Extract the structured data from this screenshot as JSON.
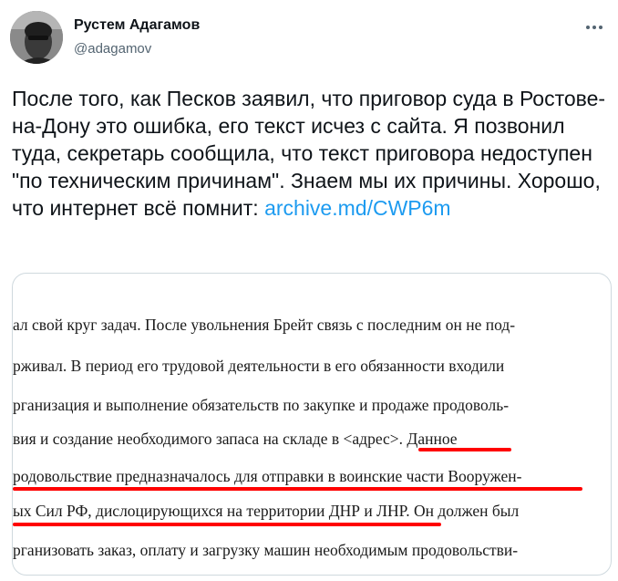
{
  "author": {
    "name": "Рустем Адагамов",
    "handle": "@adagamov"
  },
  "icons": {
    "more": "more-horizontal-icon",
    "avatar": "profile-photo"
  },
  "tweet": {
    "text": "После того, как Песков заявил, что приговор суда в Ростове-на-Дону это ошибка, его текст исчез с сайта. Я позвонил туда, секретарь сообщила, что текст приговора недоступен \"по техническим причинам\". Знаем мы их причины. Хорошо, что интернет всё помнит: ",
    "link": "archive.md/CWP6m"
  },
  "document_image": {
    "lines": [
      "ал свой круг задач. После увольнения Брейт связь с последним он не под-",
      "рживал. В период его трудовой деятельности в его обязанности входили",
      "рганизация и выполнение обязательств по закупке и продаже продоволь-",
      "вия и создание необходимого запаса на складе в <адрес>. Данное",
      "родовольствие предназначалось для отправки в воинские части Вооружен-",
      "ых Сил РФ, дислоцирующихся на территории ДНР и ЛНР. Он должен был",
      "рганизовать заказ, оплату и загрузку машин необходимым продовольстви-"
    ],
    "highlight_color": "#ff0000"
  },
  "colors": {
    "link": "#1d9bf0",
    "text": "#0f1419",
    "secondary": "#536471"
  }
}
